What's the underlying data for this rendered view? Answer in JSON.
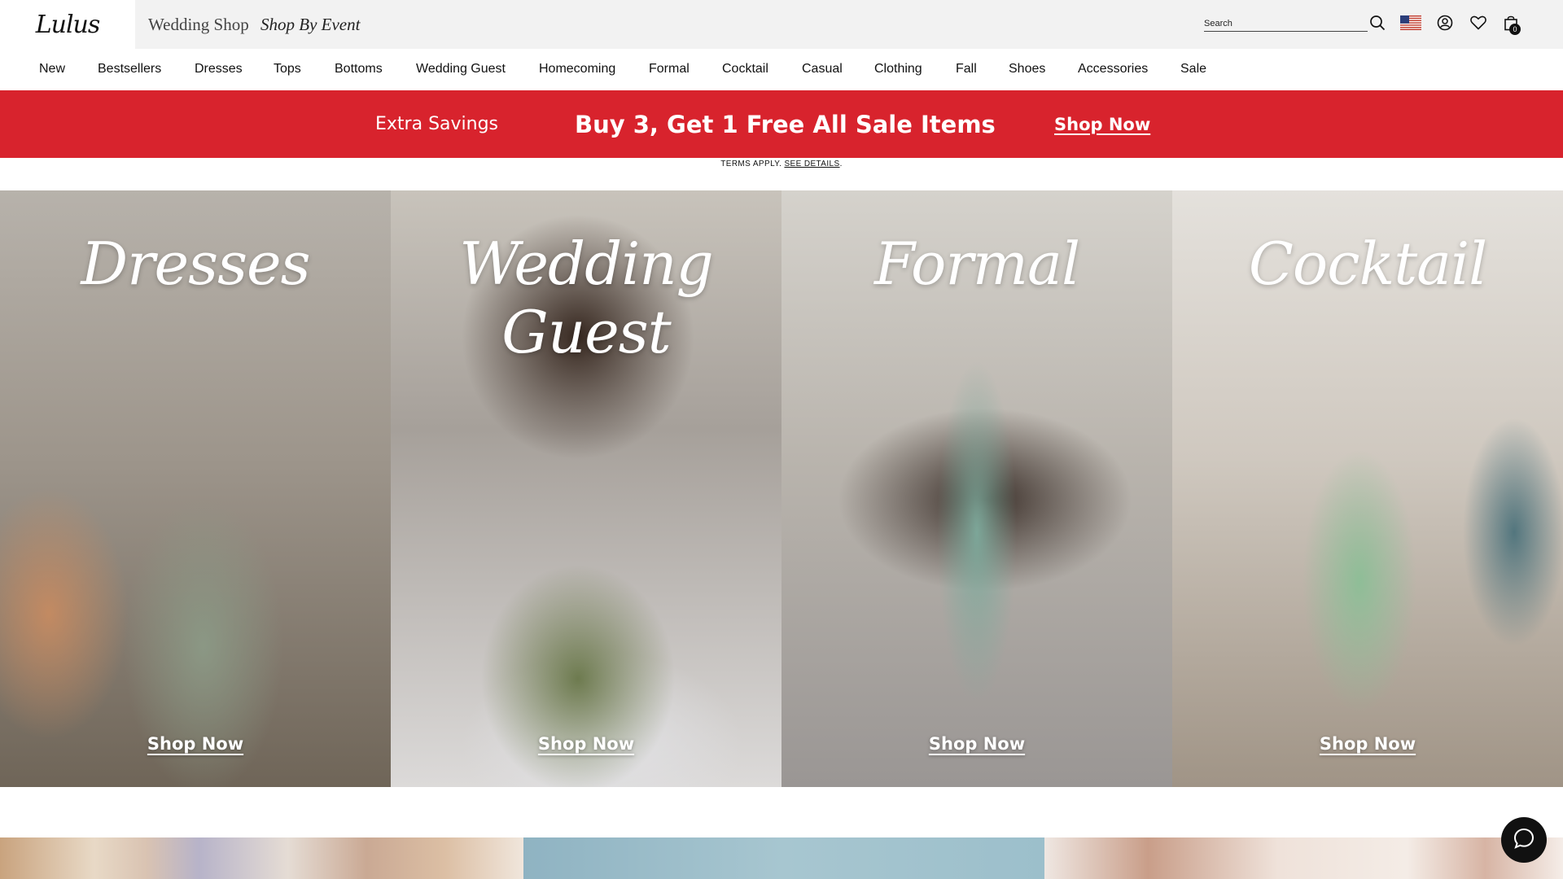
{
  "header": {
    "logo": "Lulus",
    "site_tabs": [
      "Wedding Shop",
      "Shop By Event"
    ],
    "search": {
      "placeholder": "Search",
      "value": ""
    },
    "icons": [
      "search-icon",
      "us-flag-icon",
      "account-icon",
      "heart-icon",
      "shopping-bag-icon"
    ],
    "bag_count": "0"
  },
  "nav": {
    "items": [
      "New",
      "Bestsellers",
      "Dresses",
      "Tops",
      "Bottoms",
      "Wedding Guest",
      "Homecoming",
      "Formal",
      "Cocktail",
      "Casual",
      "Clothing",
      "Fall",
      "Shoes",
      "Accessories",
      "Sale"
    ]
  },
  "promo": {
    "label": "Extra Savings",
    "headline": "Buy 3, Get 1 Free All Sale Items",
    "cta": "Shop Now",
    "terms_prefix": "TERMS APPLY.",
    "terms_link": "SEE DETAILS",
    "terms_suffix": ".",
    "background": "#d8232d"
  },
  "hero": {
    "panels": [
      {
        "title": "Dresses",
        "cta": "Shop Now"
      },
      {
        "title": "Wedding Guest",
        "cta": "Shop Now"
      },
      {
        "title": "Formal",
        "cta": "Shop Now"
      },
      {
        "title": "Cocktail",
        "cta": "Shop Now"
      }
    ]
  },
  "chat": {
    "icon": "chat-icon"
  }
}
